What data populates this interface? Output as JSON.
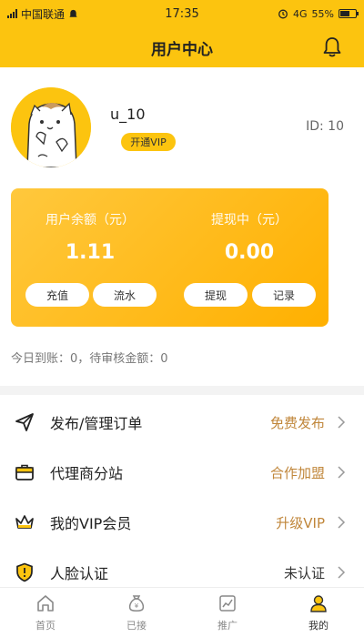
{
  "status_bar": {
    "carrier": "中国联通",
    "time": "17:35",
    "network": "4G",
    "battery": "55%"
  },
  "header": {
    "title": "用户中心"
  },
  "profile": {
    "username": "u_10",
    "vip_button": "开通VIP",
    "user_id": "ID: 10"
  },
  "balance_card": {
    "left": {
      "label": "用户余额（元）",
      "amount": "1.11",
      "buttons": [
        "充值",
        "流水"
      ]
    },
    "right": {
      "label": "提现中（元）",
      "amount": "0.00",
      "buttons": [
        "提现",
        "记录"
      ]
    }
  },
  "today_line": "今日到账：0，待审核金额：0",
  "menu": [
    {
      "label": "发布/管理订单",
      "value": "免费发布",
      "value_color": "#c0863a",
      "icon": "send-icon"
    },
    {
      "label": "代理商分站",
      "value": "合作加盟",
      "value_color": "#c0863a",
      "icon": "briefcase-icon"
    },
    {
      "label": "我的VIP会员",
      "value": "升级VIP",
      "value_color": "#c0863a",
      "icon": "crown-icon"
    },
    {
      "label": "人脸认证",
      "value": "未认证",
      "value_color": "#333333",
      "icon": "shield-icon"
    }
  ],
  "tabs": [
    {
      "label": "首页",
      "icon": "home-icon"
    },
    {
      "label": "已接",
      "icon": "money-bag-icon"
    },
    {
      "label": "推广",
      "icon": "chart-icon"
    },
    {
      "label": "我的",
      "icon": "user-icon",
      "active": true
    }
  ],
  "colors": {
    "brand": "#fcc40f",
    "card": "#ffb000",
    "accent_text": "#c0863a"
  }
}
